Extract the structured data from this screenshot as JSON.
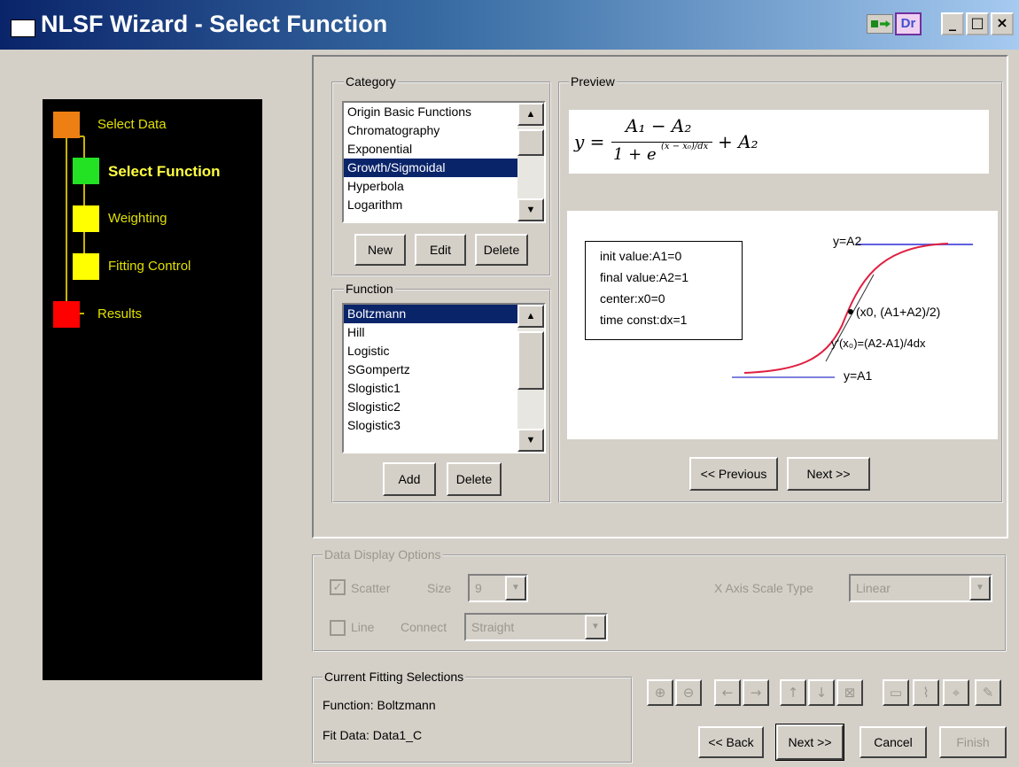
{
  "window": {
    "title": "NLSF Wizard - Select Function",
    "min": "_",
    "max": "□",
    "close": "×",
    "dr_label": "Dr"
  },
  "steps": [
    {
      "label": "Select Data",
      "color": "#ee7f12"
    },
    {
      "label": "Select Function",
      "color": "#23e223"
    },
    {
      "label": "Weighting",
      "color": "#ffff00"
    },
    {
      "label": "Fitting Control",
      "color": "#ffff00"
    },
    {
      "label": "Results",
      "color": "#ff0000"
    }
  ],
  "category": {
    "label": "Category",
    "items": [
      "Origin Basic Functions",
      "Chromatography",
      "Exponential",
      "Growth/Sigmoidal",
      "Hyperbola",
      "Logarithm"
    ],
    "selected": 3,
    "new": "New",
    "edit": "Edit",
    "delete": "Delete"
  },
  "function": {
    "label": "Function",
    "items": [
      "Boltzmann",
      "Hill",
      "Logistic",
      "SGompertz",
      "Slogistic1",
      "Slogistic2",
      "Slogistic3"
    ],
    "selected": 0,
    "add": "Add",
    "delete": "Delete"
  },
  "preview": {
    "label": "Preview",
    "formula": {
      "y": "y =",
      "num": "A₁ − A₂",
      "den": "1 + e",
      "exp": "(x − x₀)/dx",
      "tail": "+ A₂"
    },
    "info": [
      "init value:A1=0",
      "final value:A2=1",
      "center:x0=0",
      "time const:dx=1"
    ],
    "labels": {
      "top": "y=A2",
      "center": "(x0, (A1+A2)/2)",
      "slope": "y'(x₀)=(A2-A1)/4dx",
      "bottom": "y=A1"
    },
    "prev": "<< Previous",
    "next": "Next >>"
  },
  "display": {
    "label": "Data Display Options",
    "scatter": "Scatter",
    "size_label": "Size",
    "size_val": "9",
    "line": "Line",
    "connect_label": "Connect",
    "connect_val": "Straight",
    "xaxis_label": "X Axis Scale Type",
    "xaxis_val": "Linear"
  },
  "current": {
    "label": "Current Fitting Selections",
    "function": "Function:  Boltzmann",
    "fitdata": "Fit Data:  Data1_C"
  },
  "footer": {
    "back": "<< Back",
    "next": "Next >>",
    "cancel": "Cancel",
    "finish": "Finish"
  },
  "tool_icons": [
    "zoom-in-icon",
    "zoom-out-icon",
    "arrow-left-icon",
    "arrow-right-icon",
    "arrow-up-icon",
    "arrow-down-icon",
    "fit-icon",
    "window-icon",
    "graph-icon",
    "pin-icon",
    "edit-icon"
  ]
}
